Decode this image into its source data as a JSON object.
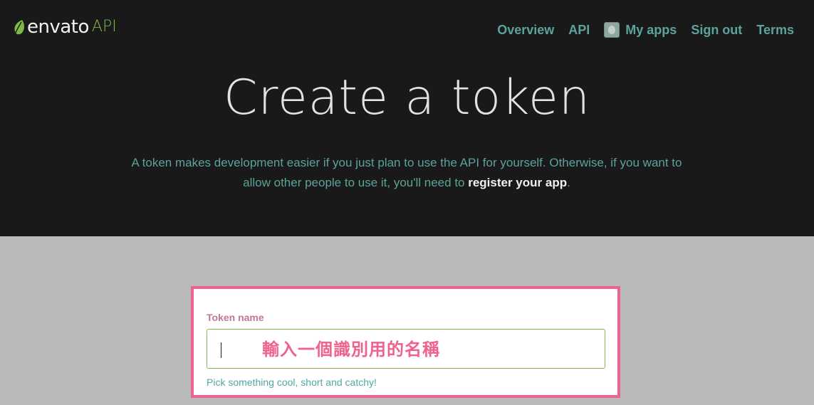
{
  "header": {
    "logo": {
      "word": "envato",
      "suffix": "API",
      "icon": "envato-leaf-icon"
    },
    "nav": {
      "items": [
        {
          "label": "Overview"
        },
        {
          "label": "API"
        },
        {
          "label": "My apps",
          "icon": "user-avatar-icon"
        },
        {
          "label": "Sign out"
        },
        {
          "label": "Terms"
        }
      ]
    }
  },
  "hero": {
    "title": "Create a token",
    "intro_text": "A token makes development easier if you just plan to use the API for yourself. Otherwise, if you want to allow other people to use it, you'll need to ",
    "intro_link": "register your app",
    "intro_end": "."
  },
  "form": {
    "token_name_label": "Token name",
    "token_name_value": "",
    "annotation": "輸入一個識別用的名稱",
    "hint": "Pick something cool, short and catchy!"
  },
  "colors": {
    "header_bg": "#181918",
    "page_bg": "#bababa",
    "nav_link": "#5ca39c",
    "brand_green": "#7fb843",
    "highlight_pink": "#f0628e",
    "input_border": "#87b84f"
  }
}
